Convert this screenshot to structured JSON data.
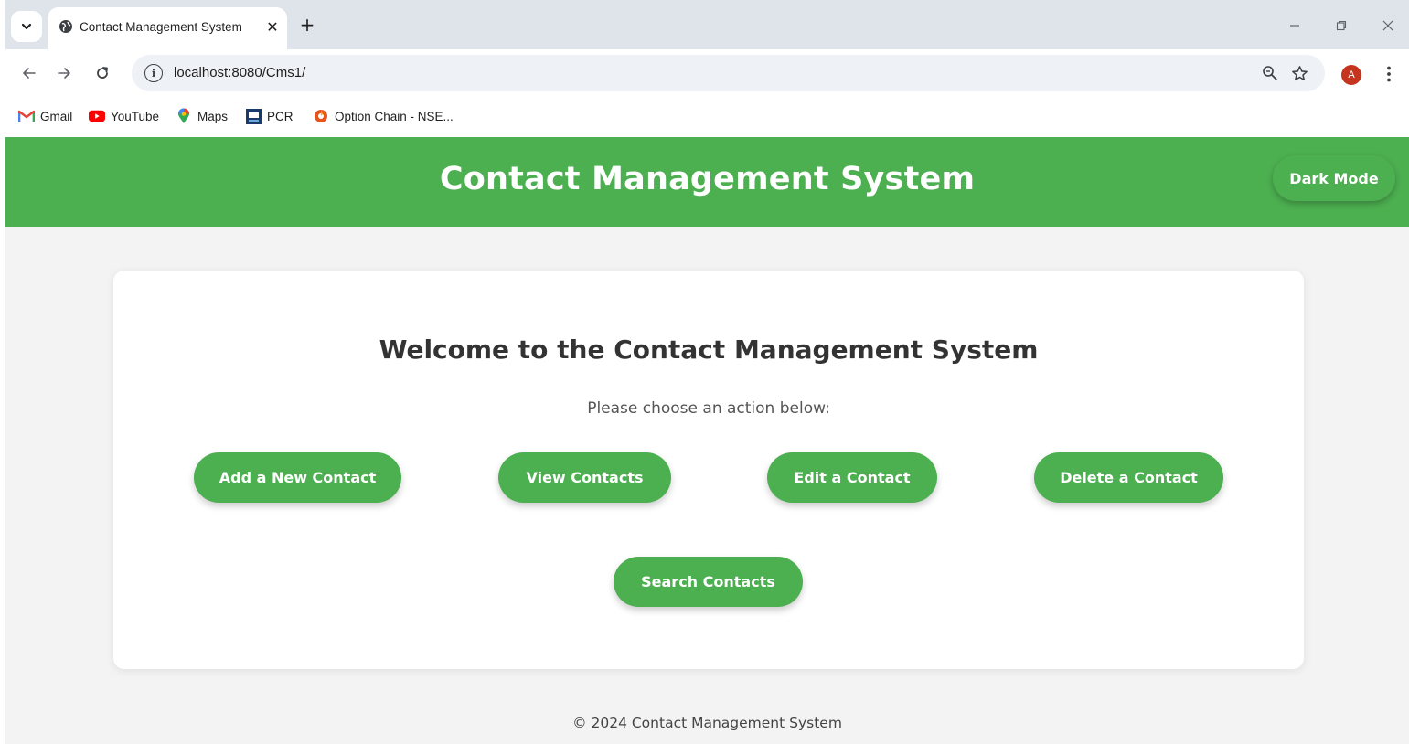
{
  "browser": {
    "tab_title": "Contact Management System",
    "close_glyph": "✕",
    "new_tab_glyph": "+",
    "url": "localhost:8080/Cms1/",
    "profile_initial": "A",
    "profile_color": "#c5341f",
    "bookmarks": [
      {
        "label": "Gmail",
        "icon": "gmail-icon"
      },
      {
        "label": "YouTube",
        "icon": "youtube-icon"
      },
      {
        "label": "Maps",
        "icon": "maps-icon"
      },
      {
        "label": "PCR",
        "icon": "pcr-icon"
      },
      {
        "label": "Option Chain - NSE...",
        "icon": "option-chain-icon"
      }
    ]
  },
  "app": {
    "title": "Contact Management System",
    "dark_mode_label": "Dark Mode",
    "accent_color": "#4caf50",
    "welcome_heading": "Welcome to the Contact Management System",
    "subtitle": "Please choose an action below:",
    "actions": [
      {
        "label": "Add a New Contact"
      },
      {
        "label": "View Contacts"
      },
      {
        "label": "Edit a Contact"
      },
      {
        "label": "Delete a Contact"
      },
      {
        "label": "Search Contacts"
      }
    ],
    "footer": "© 2024 Contact Management System"
  }
}
